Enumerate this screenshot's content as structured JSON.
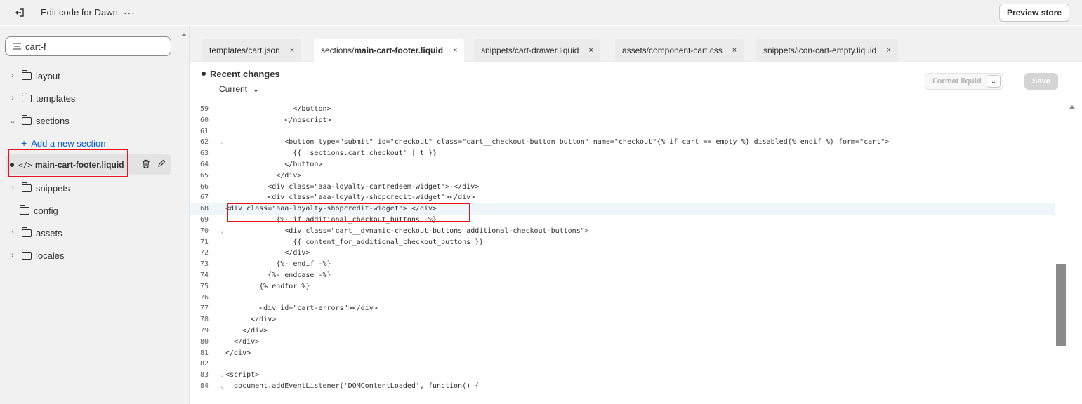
{
  "app": {
    "title": "Edit code for Dawn",
    "more": "···",
    "preview_label": "Preview store"
  },
  "search": {
    "value": "cart-f"
  },
  "sidebar": {
    "folders": [
      {
        "label": "layout"
      },
      {
        "label": "templates"
      },
      {
        "label": "sections"
      },
      {
        "label": "snippets"
      },
      {
        "label": "config"
      },
      {
        "label": "assets"
      },
      {
        "label": "locales"
      }
    ],
    "add_section_label": "Add a new section",
    "file": {
      "icon_text": "</>",
      "label": "main-cart-footer.liquid"
    }
  },
  "tabs": [
    {
      "prefix": "templates/cart.json",
      "bold": "",
      "close": "×"
    },
    {
      "prefix": "sections/",
      "bold": "main-cart-footer.liquid",
      "close": "×"
    },
    {
      "prefix": "snippets/cart-drawer.liquid",
      "bold": "",
      "close": "×"
    },
    {
      "prefix": "assets/component-cart.css",
      "bold": "",
      "close": "×"
    },
    {
      "prefix": "snippets/icon-cart-empty.liquid",
      "bold": "",
      "close": "×"
    }
  ],
  "changes": {
    "title": "Recent changes",
    "selected": "Current",
    "format_label": "Format liquid",
    "save_label": "Save"
  },
  "editor": {
    "current_line": 68,
    "lines": [
      {
        "n": "59",
        "code": "                </button>"
      },
      {
        "n": "60",
        "code": "              </noscript>"
      },
      {
        "n": "61",
        "code": ""
      },
      {
        "n": "62",
        "code": "              <button type=\"submit\" id=\"checkout\" class=\"cart__checkout-button button\" name=\"checkout\"{% if cart == empty %} disabled{% endif %} form=\"cart\">"
      },
      {
        "n": "63",
        "code": "                {{ 'sections.cart.checkout' | t }}"
      },
      {
        "n": "64",
        "code": "              </button>"
      },
      {
        "n": "65",
        "code": "            </div>"
      },
      {
        "n": "66",
        "code": "          <div class=\"aaa-loyalty-cartredeem-widget\"> </div>"
      },
      {
        "n": "67",
        "code": "          <div class=\"aaa-loyalty-shopcredit-widget\"></div>"
      },
      {
        "n": "68",
        "code": "<div class=\"aaa-loyalty-shopcredit-widget\"> </div>"
      },
      {
        "n": "69",
        "code": "            {%- if additional_checkout_buttons -%}"
      },
      {
        "n": "70",
        "code": "              <div class=\"cart__dynamic-checkout-buttons additional-checkout-buttons\">"
      },
      {
        "n": "71",
        "code": "                {{ content_for_additional_checkout_buttons }}"
      },
      {
        "n": "72",
        "code": "              </div>"
      },
      {
        "n": "73",
        "code": "            {%- endif -%}"
      },
      {
        "n": "74",
        "code": "          {%- endcase -%}"
      },
      {
        "n": "75",
        "code": "        {% endfor %}"
      },
      {
        "n": "76",
        "code": ""
      },
      {
        "n": "77",
        "code": "        <div id=\"cart-errors\"></div>"
      },
      {
        "n": "78",
        "code": "      </div>"
      },
      {
        "n": "79",
        "code": "    </div>"
      },
      {
        "n": "80",
        "code": "  </div>"
      },
      {
        "n": "81",
        "code": "</div>"
      },
      {
        "n": "82",
        "code": ""
      },
      {
        "n": "83",
        "code": "<script>"
      },
      {
        "n": "84",
        "code": "  document.addEventListener('DOMContentLoaded', function() {"
      }
    ]
  },
  "colors": {
    "highlight": "#e8141b",
    "link": "#005bd3",
    "string": "#0f7a6e"
  }
}
